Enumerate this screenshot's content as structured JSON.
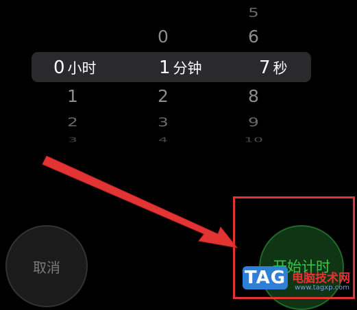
{
  "picker": {
    "hours": {
      "value": "0",
      "unit": "小时",
      "below": [
        "1",
        "2",
        "3"
      ]
    },
    "minutes": {
      "above": [
        "0"
      ],
      "value": "1",
      "unit": "分钟",
      "below": [
        "2",
        "3",
        "4"
      ]
    },
    "seconds": {
      "above": [
        "5",
        "6"
      ],
      "value": "7",
      "unit": "秒",
      "below": [
        "8",
        "9",
        "10"
      ]
    }
  },
  "buttons": {
    "cancel_label": "取消",
    "start_label": "开始计时"
  },
  "colors": {
    "background": "#000000",
    "annotation": "#e33434",
    "start_green": "#3cc54a"
  },
  "watermark": {
    "logo": "TAG",
    "site_name": "电脑技术网",
    "url": "www.tagxp.com"
  }
}
